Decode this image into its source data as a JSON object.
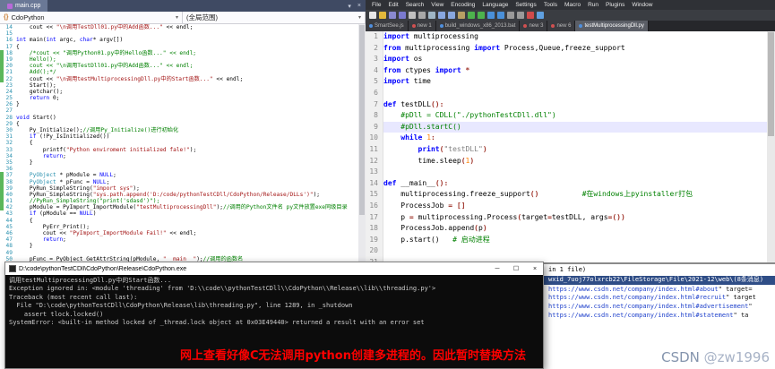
{
  "vs": {
    "tab_title": "main.cpp",
    "controls": {
      "dropdown": "▾",
      "close": "×"
    },
    "nav_scope": "CdoPython",
    "nav_member": "(全局范围)",
    "code_lines": [
      {
        "n": 14,
        "m": "",
        "s": [
          [
            "    cout << ",
            "p"
          ],
          [
            "\"\\n调用TestDll01.py中的Add函数...\"",
            "s"
          ],
          [
            " << endl;",
            "p"
          ]
        ]
      },
      {
        "n": 15,
        "m": "",
        "s": []
      },
      {
        "n": 16,
        "m": "",
        "s": [
          [
            "int",
            "k"
          ],
          [
            " main(",
            "p"
          ],
          [
            "int",
            "k"
          ],
          [
            " argc, ",
            "p"
          ],
          [
            "char",
            "k"
          ],
          [
            "* argv[])",
            "p"
          ]
        ]
      },
      {
        "n": 17,
        "m": "",
        "s": [
          [
            "{",
            "p"
          ]
        ]
      },
      {
        "n": 18,
        "m": "g",
        "s": [
          [
            "    /*cout << \"调用Python01.py中的Hello函数...\" << endl;",
            "c"
          ]
        ]
      },
      {
        "n": 19,
        "m": "g",
        "s": [
          [
            "    Hello();",
            "c"
          ]
        ]
      },
      {
        "n": 20,
        "m": "g",
        "s": [
          [
            "    cout << \"\\n调用TestDll01.py中的Add函数...\" << endl;",
            "c"
          ]
        ]
      },
      {
        "n": 21,
        "m": "g",
        "s": [
          [
            "    Add();*/",
            "c"
          ]
        ]
      },
      {
        "n": 22,
        "m": "g",
        "s": [
          [
            "    cout << ",
            "p"
          ],
          [
            "\"\\n调用testMultiprocessingDll.py中的Start函数...\"",
            "s"
          ],
          [
            " << endl;",
            "p"
          ]
        ]
      },
      {
        "n": 23,
        "m": "",
        "s": [
          [
            "    Start();",
            "p"
          ]
        ]
      },
      {
        "n": 24,
        "m": "",
        "s": [
          [
            "    getchar();",
            "p"
          ]
        ]
      },
      {
        "n": 25,
        "m": "",
        "s": [
          [
            "    ",
            "p"
          ],
          [
            "return",
            "k"
          ],
          [
            " 0;",
            "p"
          ]
        ]
      },
      {
        "n": 26,
        "m": "",
        "s": [
          [
            "}",
            "p"
          ]
        ]
      },
      {
        "n": 27,
        "m": "",
        "s": []
      },
      {
        "n": 28,
        "m": "",
        "s": [
          [
            "void",
            "k"
          ],
          [
            " Start()",
            "p"
          ]
        ]
      },
      {
        "n": 29,
        "m": "",
        "s": [
          [
            "{",
            "p"
          ]
        ]
      },
      {
        "n": 30,
        "m": "",
        "s": [
          [
            "    Py_Initialize();",
            "p"
          ],
          [
            "//调用Py_Initialize()进行初始化",
            "c"
          ]
        ]
      },
      {
        "n": 31,
        "m": "",
        "s": [
          [
            "    ",
            "p"
          ],
          [
            "if",
            "k"
          ],
          [
            " (!Py_IsInitialized())",
            "p"
          ]
        ]
      },
      {
        "n": 32,
        "m": "",
        "s": [
          [
            "    {",
            "p"
          ]
        ]
      },
      {
        "n": 33,
        "m": "",
        "s": [
          [
            "        printf(",
            "p"
          ],
          [
            "\"Python enviroment initialized fale!\"",
            "s"
          ],
          [
            ");",
            "p"
          ]
        ]
      },
      {
        "n": 34,
        "m": "",
        "s": [
          [
            "        ",
            "p"
          ],
          [
            "return",
            "k"
          ],
          [
            ";",
            "p"
          ]
        ]
      },
      {
        "n": 35,
        "m": "",
        "s": [
          [
            "    }",
            "p"
          ]
        ]
      },
      {
        "n": 36,
        "m": "",
        "s": []
      },
      {
        "n": 37,
        "m": "g",
        "s": [
          [
            "    ",
            "p"
          ],
          [
            "PyObject",
            "t"
          ],
          [
            " * pModule = ",
            "p"
          ],
          [
            "NULL",
            "k"
          ],
          [
            ";",
            "p"
          ]
        ]
      },
      {
        "n": 38,
        "m": "g",
        "s": [
          [
            "    ",
            "p"
          ],
          [
            "PyObject",
            "t"
          ],
          [
            " * pFunc = ",
            "p"
          ],
          [
            "NULL",
            "k"
          ],
          [
            ";",
            "p"
          ]
        ]
      },
      {
        "n": 39,
        "m": "g",
        "s": [
          [
            "    PyRun_SimpleString(",
            "p"
          ],
          [
            "\"import sys\"",
            "s"
          ],
          [
            ");",
            "p"
          ]
        ]
      },
      {
        "n": 40,
        "m": "g",
        "s": [
          [
            "    PyRun_SimpleString(",
            "p"
          ],
          [
            "\"sys.path.append('D:/code/pythonTestCDll/CdoPython/Release/DLLs')\"",
            "s"
          ],
          [
            ");",
            "p"
          ]
        ]
      },
      {
        "n": 41,
        "m": "g",
        "s": [
          [
            "    //PyRun_SimpleString(\"print('sdasd')\");",
            "c"
          ]
        ]
      },
      {
        "n": 42,
        "m": "g",
        "s": [
          [
            "    pModule = PyImport_ImportModule(",
            "p"
          ],
          [
            "\"testMultiprocessingDll\"",
            "s"
          ],
          [
            ");",
            "p"
          ],
          [
            "//调用的Python文件名 py文件放置exe同级目录",
            "c"
          ]
        ]
      },
      {
        "n": 43,
        "m": "",
        "s": [
          [
            "    ",
            "p"
          ],
          [
            "if",
            "k"
          ],
          [
            " (pModule == ",
            "p"
          ],
          [
            "NULL",
            "k"
          ],
          [
            ")",
            "p"
          ]
        ]
      },
      {
        "n": 44,
        "m": "",
        "s": [
          [
            "    {",
            "p"
          ]
        ]
      },
      {
        "n": 45,
        "m": "",
        "s": [
          [
            "        PyErr_Print();",
            "p"
          ]
        ]
      },
      {
        "n": 46,
        "m": "",
        "s": [
          [
            "        cout << ",
            "p"
          ],
          [
            "\"PyImport_ImportModule Fail!\"",
            "s"
          ],
          [
            " << endl;",
            "p"
          ]
        ]
      },
      {
        "n": 47,
        "m": "",
        "s": [
          [
            "        ",
            "p"
          ],
          [
            "return",
            "k"
          ],
          [
            ";",
            "p"
          ]
        ]
      },
      {
        "n": 48,
        "m": "",
        "s": [
          [
            "    }",
            "p"
          ]
        ]
      },
      {
        "n": 49,
        "m": "",
        "s": []
      },
      {
        "n": 50,
        "m": "",
        "s": [
          [
            "    pFunc = PyObject_GetAttrString(pModule, ",
            "p"
          ],
          [
            "\"__main__\"",
            "s"
          ],
          [
            ");",
            "p"
          ],
          [
            "//调用的函数名",
            "c"
          ]
        ]
      }
    ]
  },
  "npp": {
    "menu": [
      "File",
      "Edit",
      "Search",
      "View",
      "Encoding",
      "Language",
      "Settings",
      "Tools",
      "Macro",
      "Run",
      "Plugins",
      "Window"
    ],
    "toolbar_icons": [
      {
        "name": "new-file-icon",
        "color": "#e8e8e8"
      },
      {
        "name": "open-file-icon",
        "color": "#e3b93c"
      },
      {
        "name": "save-icon",
        "color": "#8a8ad0"
      },
      {
        "name": "save-all-icon",
        "color": "#7a7ad0"
      },
      {
        "name": "close-icon",
        "color": "#c0c0c0"
      },
      {
        "name": "close-all-icon",
        "color": "#a8a8a8"
      },
      {
        "name": "print-icon",
        "color": "#9fb6c6"
      },
      {
        "name": "cut-icon",
        "color": "#88a7e0"
      },
      {
        "name": "copy-icon",
        "color": "#88a7e0"
      },
      {
        "name": "paste-icon",
        "color": "#b9a064"
      },
      {
        "name": "undo-icon",
        "color": "#4db34d"
      },
      {
        "name": "redo-icon",
        "color": "#4db34d"
      },
      {
        "name": "find-icon",
        "color": "#4a90d9"
      },
      {
        "name": "replace-icon",
        "color": "#4a90d9"
      },
      {
        "name": "zoom-in-icon",
        "color": "#9a9a9a"
      },
      {
        "name": "zoom-out-icon",
        "color": "#9a9a9a"
      },
      {
        "name": "macro-record-icon",
        "color": "#d04b4b"
      },
      {
        "name": "macro-play-icon",
        "color": "#5fa0e0"
      }
    ],
    "tabs": [
      {
        "label": "SmartSee.js",
        "state": "saved",
        "active": false
      },
      {
        "label": "new 1",
        "state": "modified",
        "active": false
      },
      {
        "label": "build_windows_x86_2013.bat",
        "state": "saved",
        "active": false
      },
      {
        "label": "new 3",
        "state": "modified",
        "active": false
      },
      {
        "label": "new 6",
        "state": "modified",
        "active": false
      },
      {
        "label": "testMultiprocessingDll.py",
        "state": "saved",
        "active": true
      }
    ],
    "code_lines": [
      {
        "n": 1,
        "cur": false,
        "s": [
          [
            "import",
            "k"
          ],
          [
            " multiprocessing",
            "p"
          ]
        ]
      },
      {
        "n": 2,
        "cur": false,
        "s": [
          [
            "from",
            "k"
          ],
          [
            " multiprocessing ",
            "p"
          ],
          [
            "import",
            "k"
          ],
          [
            " Process,Queue,freeze_support",
            "p"
          ]
        ]
      },
      {
        "n": 3,
        "cur": false,
        "s": [
          [
            "import",
            "k"
          ],
          [
            " os",
            "p"
          ]
        ]
      },
      {
        "n": 4,
        "cur": false,
        "s": [
          [
            "from",
            "k"
          ],
          [
            " ctypes ",
            "p"
          ],
          [
            "import",
            "k"
          ],
          [
            " ",
            "p"
          ],
          [
            "*",
            "o"
          ]
        ]
      },
      {
        "n": 5,
        "cur": false,
        "s": [
          [
            "import",
            "k"
          ],
          [
            " time",
            "p"
          ]
        ]
      },
      {
        "n": 6,
        "cur": false,
        "s": []
      },
      {
        "n": 7,
        "cur": false,
        "s": [
          [
            "def",
            "k"
          ],
          [
            " testDLL",
            "p"
          ],
          [
            "():",
            "o"
          ]
        ]
      },
      {
        "n": 8,
        "cur": false,
        "s": [
          [
            "    #pDll = CDLL(\"./pythonTestCDll.dll\")",
            "c"
          ]
        ]
      },
      {
        "n": 9,
        "cur": true,
        "s": [
          [
            "    #pDll.startC()",
            "c"
          ]
        ]
      },
      {
        "n": 10,
        "cur": false,
        "s": [
          [
            "    ",
            "p"
          ],
          [
            "while",
            "k"
          ],
          [
            " ",
            "p"
          ],
          [
            "1",
            "n"
          ],
          [
            ":",
            "o"
          ]
        ]
      },
      {
        "n": 11,
        "cur": false,
        "s": [
          [
            "        ",
            "p"
          ],
          [
            "print",
            "k"
          ],
          [
            "(",
            "o"
          ],
          [
            "\"testDLL\"",
            "s"
          ],
          [
            ")",
            "o"
          ]
        ]
      },
      {
        "n": 12,
        "cur": false,
        "s": [
          [
            "        time.sleep",
            "p"
          ],
          [
            "(",
            "o"
          ],
          [
            "1",
            "n"
          ],
          [
            ")",
            "o"
          ]
        ]
      },
      {
        "n": 13,
        "cur": false,
        "s": []
      },
      {
        "n": 14,
        "cur": false,
        "s": [
          [
            "def",
            "k"
          ],
          [
            " __main__",
            "p"
          ],
          [
            "():",
            "o"
          ]
        ]
      },
      {
        "n": 15,
        "cur": false,
        "s": [
          [
            "    multiprocessing.freeze_support",
            "p"
          ],
          [
            "()",
            "o"
          ],
          [
            "          ",
            "p"
          ],
          [
            "#在windows上pyinstaller打包",
            "c"
          ]
        ]
      },
      {
        "n": 16,
        "cur": false,
        "s": [
          [
            "    ProcessJob ",
            "p"
          ],
          [
            "=",
            "o"
          ],
          [
            " ",
            "p"
          ],
          [
            "[]",
            "o"
          ]
        ]
      },
      {
        "n": 17,
        "cur": false,
        "s": [
          [
            "    p ",
            "p"
          ],
          [
            "=",
            "o"
          ],
          [
            " multiprocessing.Process",
            "p"
          ],
          [
            "(",
            "o"
          ],
          [
            "target",
            "p"
          ],
          [
            "=",
            "o"
          ],
          [
            "testDLL, args",
            "p"
          ],
          [
            "=",
            "o"
          ],
          [
            "())",
            "o"
          ]
        ]
      },
      {
        "n": 18,
        "cur": false,
        "s": [
          [
            "    ProcessJob.append",
            "p"
          ],
          [
            "(",
            "o"
          ],
          [
            "p",
            "p"
          ],
          [
            ")",
            "o"
          ]
        ]
      },
      {
        "n": 19,
        "cur": false,
        "s": [
          [
            "    p.start()   ",
            "p"
          ],
          [
            "# 启动进程",
            "c"
          ]
        ]
      },
      {
        "n": 20,
        "cur": false,
        "s": []
      },
      {
        "n": 21,
        "cur": false,
        "s": []
      }
    ]
  },
  "console": {
    "title": "D:\\code\\pythonTestCDll\\CdoPython\\Release\\CdoPython.exe",
    "buttons": {
      "minimize": "─",
      "maximize": "☐",
      "close": "×"
    },
    "lines": [
      "调用testMultiprocessingDll.py中的Start函数...",
      "Exception ignored in: <module 'threading' from 'D:\\\\code\\\\pythonTestCDll\\\\CdoPython\\\\Release\\\\lib\\\\threading.py'>",
      "Traceback (most recent call last):",
      "  File \"D:\\code\\pythonTestCDll\\CdoPython\\Release\\lib\\threading.py\", line 1289, in _shutdown",
      "    assert tlock.locked()",
      "SystemError: <built-in method locked of _thread.lock object at 0x03E49440> returned a result with an error set"
    ]
  },
  "find_results": {
    "header_tail": "in 1 file)",
    "file_line": "wxid_7uoj77olxrcb22\\FileStorage\\File\\2021-12\\web\\(8条消息)",
    "hits": [
      {
        "url": "https://www.csdn.net/company/index.html#about",
        "tail": "\" target="
      },
      {
        "url": "https://www.csdn.net/company/index.html#recruit",
        "tail": "\" target"
      },
      {
        "url": "https://www.csdn.net/company/index.html#advertisement",
        "tail": "\""
      },
      {
        "url": "https://www.csdn.net/company/index.html#statement",
        "tail": "\" ta"
      }
    ]
  },
  "annotation": "网上查看好像C无法调用python创建多进程的。因此暂时替换方法",
  "watermark": {
    "brand": "CSDN",
    "user": "@zw1996"
  }
}
